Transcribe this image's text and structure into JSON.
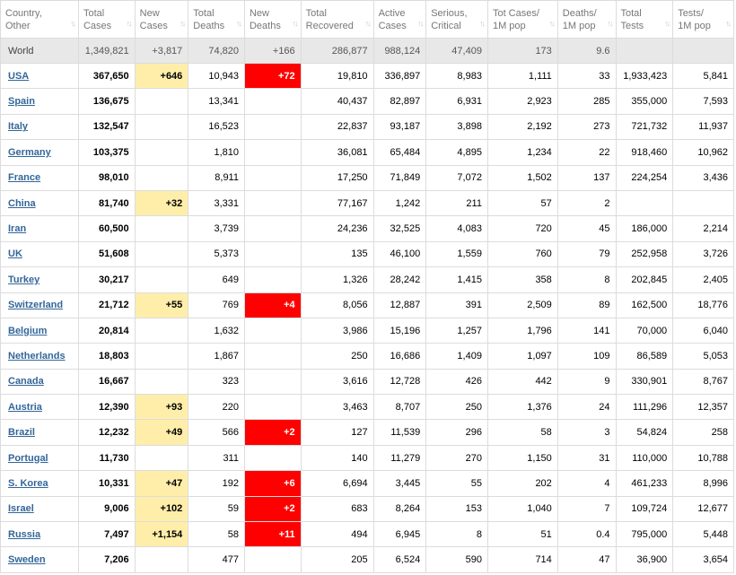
{
  "headers": [
    [
      "Country,",
      "Other"
    ],
    [
      "Total",
      "Cases"
    ],
    [
      "New",
      "Cases"
    ],
    [
      "Total",
      "Deaths"
    ],
    [
      "New",
      "Deaths"
    ],
    [
      "Total",
      "Recovered"
    ],
    [
      "Active",
      "Cases"
    ],
    [
      "Serious,",
      "Critical"
    ],
    [
      "Tot Cases/",
      "1M pop"
    ],
    [
      "Deaths/",
      "1M pop"
    ],
    [
      "Total",
      "Tests"
    ],
    [
      "Tests/",
      "1M pop"
    ]
  ],
  "world": [
    "World",
    "1,349,821",
    "+3,817",
    "74,820",
    "+166",
    "286,877",
    "988,124",
    "47,409",
    "173",
    "9.6",
    "",
    ""
  ],
  "rows": [
    [
      "USA",
      "367,650",
      "+646",
      "10,943",
      "+72",
      "19,810",
      "336,897",
      "8,983",
      "1,111",
      "33",
      "1,933,423",
      "5,841"
    ],
    [
      "Spain",
      "136,675",
      "",
      "13,341",
      "",
      "40,437",
      "82,897",
      "6,931",
      "2,923",
      "285",
      "355,000",
      "7,593"
    ],
    [
      "Italy",
      "132,547",
      "",
      "16,523",
      "",
      "22,837",
      "93,187",
      "3,898",
      "2,192",
      "273",
      "721,732",
      "11,937"
    ],
    [
      "Germany",
      "103,375",
      "",
      "1,810",
      "",
      "36,081",
      "65,484",
      "4,895",
      "1,234",
      "22",
      "918,460",
      "10,962"
    ],
    [
      "France",
      "98,010",
      "",
      "8,911",
      "",
      "17,250",
      "71,849",
      "7,072",
      "1,502",
      "137",
      "224,254",
      "3,436"
    ],
    [
      "China",
      "81,740",
      "+32",
      "3,331",
      "",
      "77,167",
      "1,242",
      "211",
      "57",
      "2",
      "",
      ""
    ],
    [
      "Iran",
      "60,500",
      "",
      "3,739",
      "",
      "24,236",
      "32,525",
      "4,083",
      "720",
      "45",
      "186,000",
      "2,214"
    ],
    [
      "UK",
      "51,608",
      "",
      "5,373",
      "",
      "135",
      "46,100",
      "1,559",
      "760",
      "79",
      "252,958",
      "3,726"
    ],
    [
      "Turkey",
      "30,217",
      "",
      "649",
      "",
      "1,326",
      "28,242",
      "1,415",
      "358",
      "8",
      "202,845",
      "2,405"
    ],
    [
      "Switzerland",
      "21,712",
      "+55",
      "769",
      "+4",
      "8,056",
      "12,887",
      "391",
      "2,509",
      "89",
      "162,500",
      "18,776"
    ],
    [
      "Belgium",
      "20,814",
      "",
      "1,632",
      "",
      "3,986",
      "15,196",
      "1,257",
      "1,796",
      "141",
      "70,000",
      "6,040"
    ],
    [
      "Netherlands",
      "18,803",
      "",
      "1,867",
      "",
      "250",
      "16,686",
      "1,409",
      "1,097",
      "109",
      "86,589",
      "5,053"
    ],
    [
      "Canada",
      "16,667",
      "",
      "323",
      "",
      "3,616",
      "12,728",
      "426",
      "442",
      "9",
      "330,901",
      "8,767"
    ],
    [
      "Austria",
      "12,390",
      "+93",
      "220",
      "",
      "3,463",
      "8,707",
      "250",
      "1,376",
      "24",
      "111,296",
      "12,357"
    ],
    [
      "Brazil",
      "12,232",
      "+49",
      "566",
      "+2",
      "127",
      "11,539",
      "296",
      "58",
      "3",
      "54,824",
      "258"
    ],
    [
      "Portugal",
      "11,730",
      "",
      "311",
      "",
      "140",
      "11,279",
      "270",
      "1,150",
      "31",
      "110,000",
      "10,788"
    ],
    [
      "S. Korea",
      "10,331",
      "+47",
      "192",
      "+6",
      "6,694",
      "3,445",
      "55",
      "202",
      "4",
      "461,233",
      "8,996"
    ],
    [
      "Israel",
      "9,006",
      "+102",
      "59",
      "+2",
      "683",
      "8,264",
      "153",
      "1,040",
      "7",
      "109,724",
      "12,677"
    ],
    [
      "Russia",
      "7,497",
      "+1,154",
      "58",
      "+11",
      "494",
      "6,945",
      "8",
      "51",
      "0.4",
      "795,000",
      "5,448"
    ],
    [
      "Sweden",
      "7,206",
      "",
      "477",
      "",
      "205",
      "6,524",
      "590",
      "714",
      "47",
      "36,900",
      "3,654"
    ]
  ],
  "colors": {
    "new_cases_highlight": "#ffeeaa",
    "new_deaths_highlight": "#ff0000",
    "link": "#336699",
    "world_row": "#e8e8e8"
  },
  "icons": {
    "sort": "sort-arrows-icon"
  }
}
